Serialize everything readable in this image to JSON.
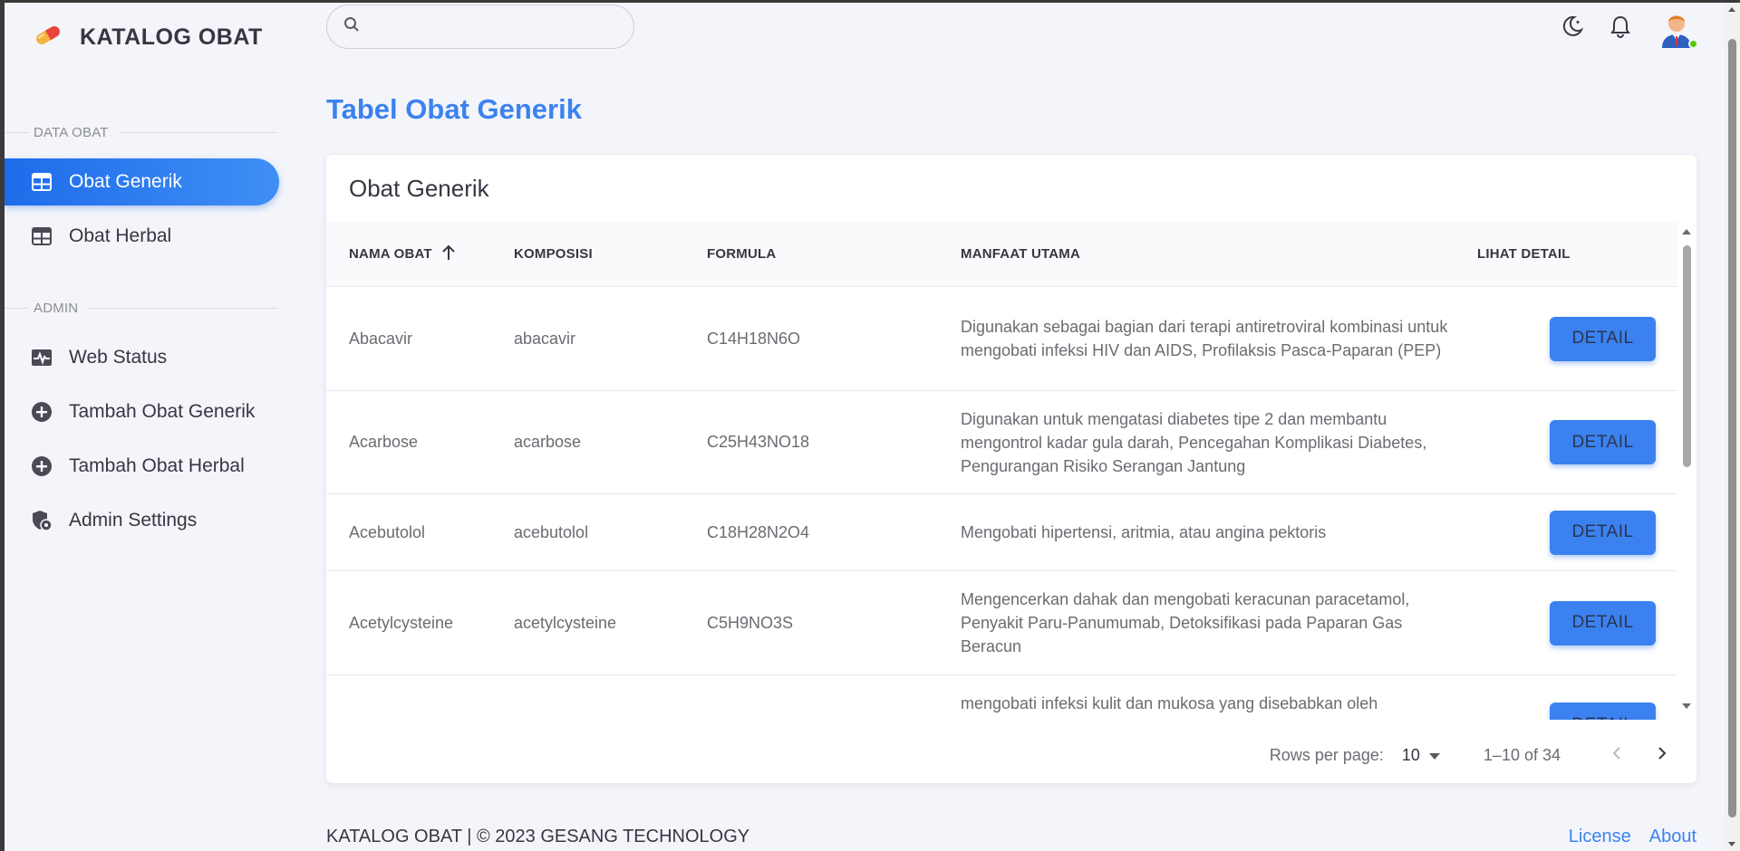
{
  "brand": {
    "title": "KATALOG OBAT",
    "icon": "pill-icon"
  },
  "sidebar": {
    "sections": [
      {
        "title": "DATA OBAT"
      },
      {
        "title": "ADMIN"
      }
    ],
    "items": [
      {
        "label": "Obat Generik",
        "icon": "table-icon",
        "active": true
      },
      {
        "label": "Obat Herbal",
        "icon": "table-icon"
      },
      {
        "label": "Web Status",
        "icon": "heartbeat-icon"
      },
      {
        "label": "Tambah Obat Generik",
        "icon": "add-circle-icon"
      },
      {
        "label": "Tambah Obat Herbal",
        "icon": "add-circle-icon"
      },
      {
        "label": "Admin Settings",
        "icon": "shield-settings-icon"
      }
    ]
  },
  "search": {
    "placeholder": ""
  },
  "page": {
    "title": "Tabel Obat Generik"
  },
  "card": {
    "title": "Obat Generik"
  },
  "table": {
    "headers": [
      "NAMA OBAT",
      "KOMPOSISI",
      "FORMULA",
      "MANFAAT UTAMA",
      "LIHAT DETAIL"
    ],
    "button_label": "DETAIL",
    "rows": [
      {
        "name": "Abacavir",
        "composition": "abacavir",
        "formula": "C14H18N6O",
        "benefit": "Digunakan sebagai bagian dari terapi antiretroviral kombinasi untuk mengobati infeksi HIV dan AIDS, Profilaksis Pasca-Paparan (PEP)"
      },
      {
        "name": "Acarbose",
        "composition": "acarbose",
        "formula": "C25H43NO18",
        "benefit": "Digunakan untuk mengatasi diabetes tipe 2 dan membantu mengontrol kadar gula darah, Pencegahan Komplikasi Diabetes, Pengurangan Risiko Serangan Jantung"
      },
      {
        "name": "Acebutolol",
        "composition": "acebutolol",
        "formula": "C18H28N2O4",
        "benefit": "Mengobati hipertensi, aritmia, atau angina pektoris"
      },
      {
        "name": "Acetylcysteine",
        "composition": "acetylcysteine",
        "formula": "C5H9NO3S",
        "benefit": "Mengencerkan dahak dan mengobati keracunan paracetamol, Penyakit Paru-Panumumab, Detoksifikasi pada Paparan Gas Beracun"
      },
      {
        "name": "",
        "composition": "",
        "formula": "",
        "benefit": "mengobati infeksi kulit dan mukosa yang disebabkan oleh"
      }
    ]
  },
  "pagination": {
    "rows_label": "Rows per page:",
    "rows_value": "10",
    "range": "1–10 of 34"
  },
  "footer": {
    "copyright": "KATALOG OBAT | © 2023 GESANG TECHNOLOGY",
    "license": "License",
    "about": "About"
  },
  "colors": {
    "accent": "#3b82f0",
    "online": "#56ca00"
  }
}
